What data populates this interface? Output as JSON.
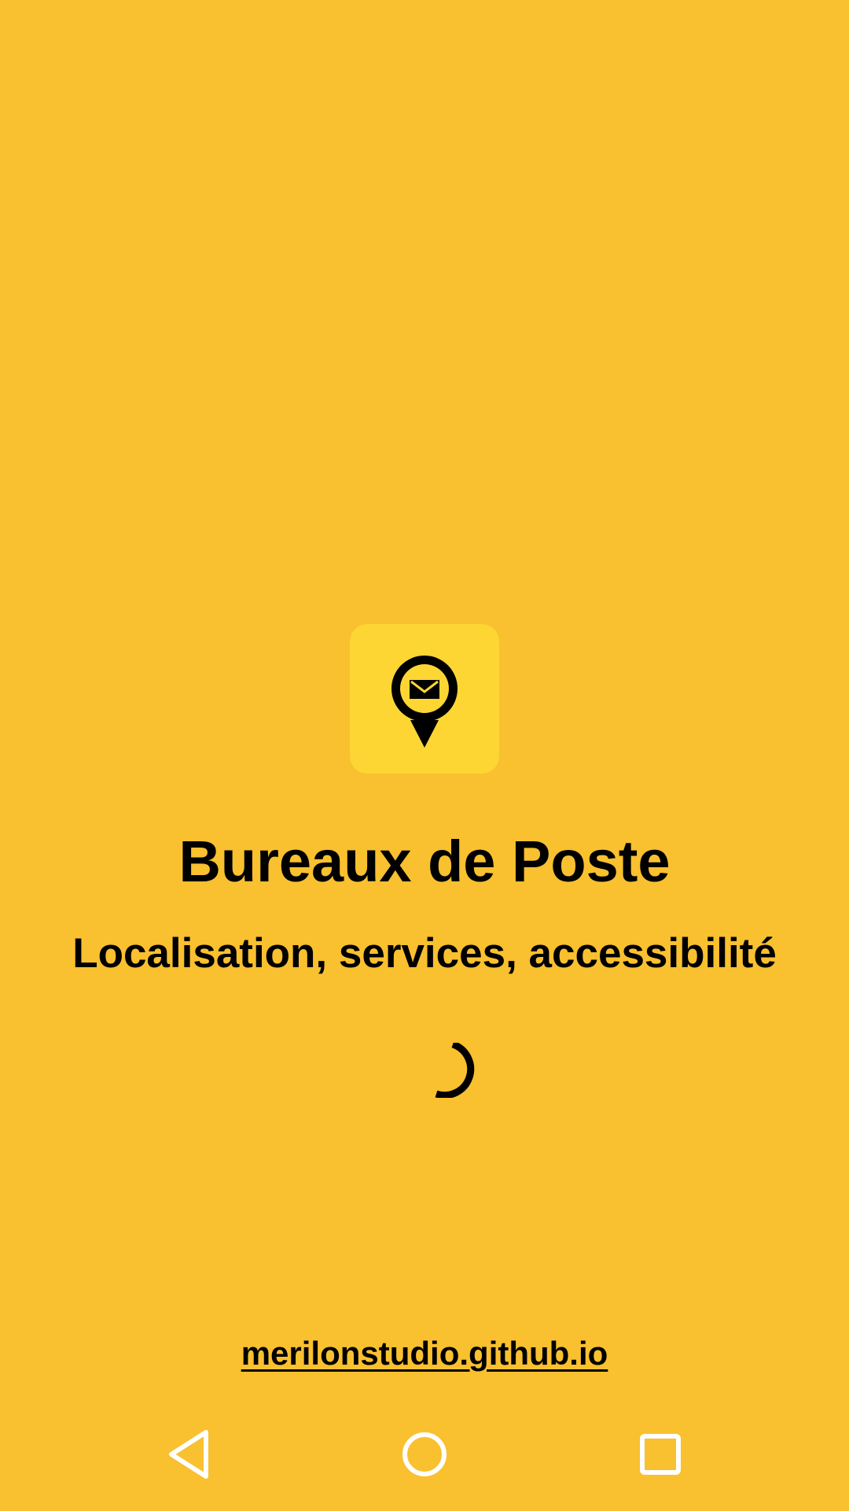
{
  "app": {
    "title": "Bureaux de Poste",
    "subtitle": "Localisation, services, accessibilité",
    "website": "merilonstudio.github.io",
    "icon": "post-office-location-pin-icon"
  },
  "loading": {
    "indicator": "loading-spinner-icon"
  },
  "navbar": {
    "back_icon": "back-triangle-icon",
    "home_icon": "home-circle-icon",
    "recents_icon": "recents-square-icon"
  },
  "colors": {
    "background": "#F9C02F",
    "icon_tile": "#FDD633",
    "foreground": "#000000",
    "nav_icons": "#FFFFFF"
  }
}
